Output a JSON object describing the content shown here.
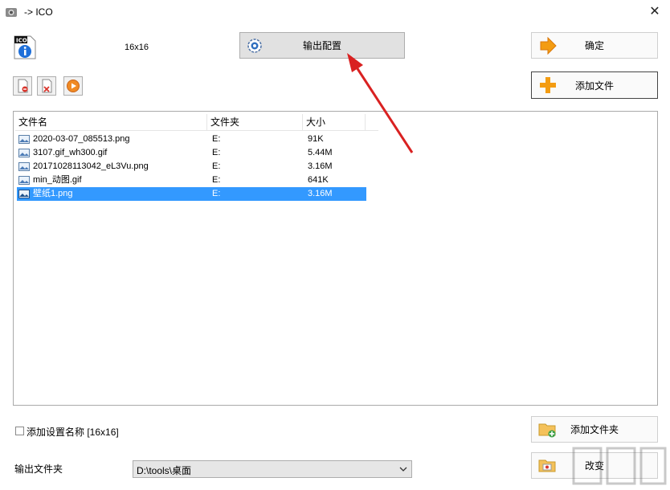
{
  "window": {
    "title": "-> ICO",
    "close_glyph": "✕"
  },
  "preset": {
    "size_label": "16x16",
    "output_config_label": "输出配置"
  },
  "buttons": {
    "ok": "确定",
    "add_file": "添加文件",
    "add_folder": "添加文件夹",
    "change": "改变"
  },
  "list": {
    "columns": [
      "文件名",
      "文件夹",
      "大小"
    ],
    "rows": [
      {
        "name": "2020-03-07_085513.png",
        "folder": "E:",
        "size": "91K"
      },
      {
        "name": "3107.gif_wh300.gif",
        "folder": "E:",
        "size": "5.44M"
      },
      {
        "name": "20171028113042_eL3Vu.png",
        "folder": "E:",
        "size": "3.16M"
      },
      {
        "name": "min_动图.gif",
        "folder": "E:",
        "size": "641K"
      },
      {
        "name": "壁纸1.png",
        "folder": "E:",
        "size": "3.16M",
        "selected": true
      }
    ]
  },
  "options": {
    "add_name_label": "添加设置名称 [16x16]",
    "add_name_checked": false
  },
  "output": {
    "folder_label": "输出文件夹",
    "folder_value": "D:\\tools\\桌面"
  },
  "icons": {
    "app": "converter-icon",
    "ico_file": "ico-file-icon",
    "gear": "gear-icon",
    "ok": "arrow-right-icon",
    "add_file": "plus-icon",
    "add_folder": "folder-add-icon",
    "change": "folder-open-icon",
    "toolbar": [
      "remove-icon",
      "delete-icon",
      "play-icon"
    ]
  },
  "colors": {
    "selection": "#3399ff",
    "annotation_arrow": "#d92121",
    "accent_orange": "#f39c12"
  }
}
